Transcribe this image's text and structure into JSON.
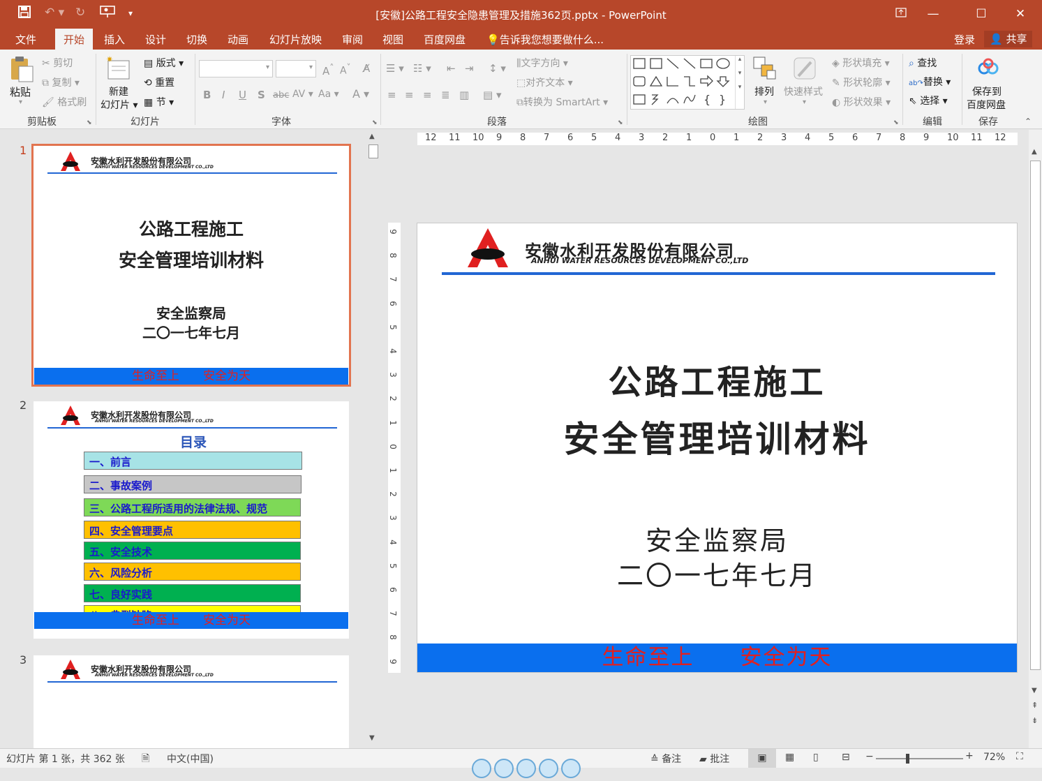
{
  "window": {
    "title": "[安徽]公路工程安全隐患管理及措施362页.pptx - PowerPoint",
    "accent": "#b7472a"
  },
  "tabs": [
    "文件",
    "开始",
    "插入",
    "设计",
    "切换",
    "动画",
    "幻灯片放映",
    "审阅",
    "视图",
    "百度网盘"
  ],
  "active_tab": "开始",
  "tell_me": "告诉我您想要做什么...",
  "account": {
    "login": "登录",
    "share": "共享"
  },
  "ribbon": {
    "clipboard": {
      "label": "剪贴板",
      "paste": "粘贴",
      "cut": "剪切",
      "copy": "复制",
      "format_painter": "格式刷"
    },
    "slides": {
      "label": "幻灯片",
      "new_slide_1": "新建",
      "new_slide_2": "幻灯片",
      "layout": "版式",
      "reset": "重置",
      "section": "节"
    },
    "font": {
      "label": "字体",
      "bold": "B",
      "italic": "I",
      "underline": "U",
      "shadow": "S",
      "strike": "abc",
      "spacing": "AV",
      "case": "Aa",
      "color": "A"
    },
    "paragraph": {
      "label": "段落",
      "text_direction": "文字方向",
      "align_text": "对齐文本",
      "smartart": "转换为 SmartArt"
    },
    "drawing": {
      "label": "绘图",
      "arrange": "排列",
      "quick_styles": "快速样式",
      "shape_fill": "形状填充",
      "shape_outline": "形状轮廓",
      "shape_effects": "形状效果"
    },
    "editing": {
      "label": "编辑",
      "find": "查找",
      "replace": "替换",
      "select": "选择"
    },
    "save": {
      "label": "保存",
      "save_to_1": "保存到",
      "save_to_2": "百度网盘"
    }
  },
  "thumbnails": {
    "nums": [
      "1",
      "2",
      "3"
    ],
    "company_cn": "安徽水利开发股份有限公司",
    "company_en": "ANHUI WATER RESOURCES DEVELOPMENT CO.,LTD",
    "footer": "生命至上　　安全为天",
    "slide1": {
      "title1": "公路工程施工",
      "title2": "安全管理培训材料",
      "sub1": "安全监察局",
      "sub2": "二〇一七年七月"
    },
    "slide2": {
      "heading": "目录",
      "items": [
        "一、前言",
        "二、事故案例",
        "三、公路工程所适用的法律法规、规范",
        "四、安全管理要点",
        "五、安全技术",
        "六、风险分析",
        "七、良好实践",
        "八、典型缺陷"
      ],
      "colors": [
        "#a7e3e6",
        "#c6c6c6",
        "#7ed957",
        "#ffc000",
        "#00b050",
        "#ffc000",
        "#00b050",
        "#ffff00"
      ]
    }
  },
  "slide": {
    "company_cn": "安徽水利开发股份有限公司",
    "company_en": "ANHUI WATER RESOURCES DEVELOPMENT CO.,LTD",
    "title1": "公路工程施工",
    "title2": "安全管理培训材料",
    "sub1": "安全监察局",
    "sub2": "二〇一七年七月",
    "footer": "生命至上　　安全为天"
  },
  "ruler": {
    "h_ticks": [
      "12",
      "11",
      "10",
      "9",
      "8",
      "7",
      "6",
      "5",
      "4",
      "3",
      "2",
      "1",
      "0",
      "1",
      "2",
      "3",
      "4",
      "5",
      "6",
      "7",
      "8",
      "9",
      "10",
      "11",
      "12"
    ],
    "v_ticks": [
      "9",
      "8",
      "7",
      "6",
      "5",
      "4",
      "3",
      "2",
      "1",
      "0",
      "1",
      "2",
      "3",
      "4",
      "5",
      "6",
      "7",
      "8",
      "9"
    ]
  },
  "status": {
    "slide_info": "幻灯片 第 1 张，共 362 张",
    "language": "中文(中国)",
    "notes": "备注",
    "comments": "批注",
    "zoom": "72%",
    "zoom_fraction": 0.72
  }
}
